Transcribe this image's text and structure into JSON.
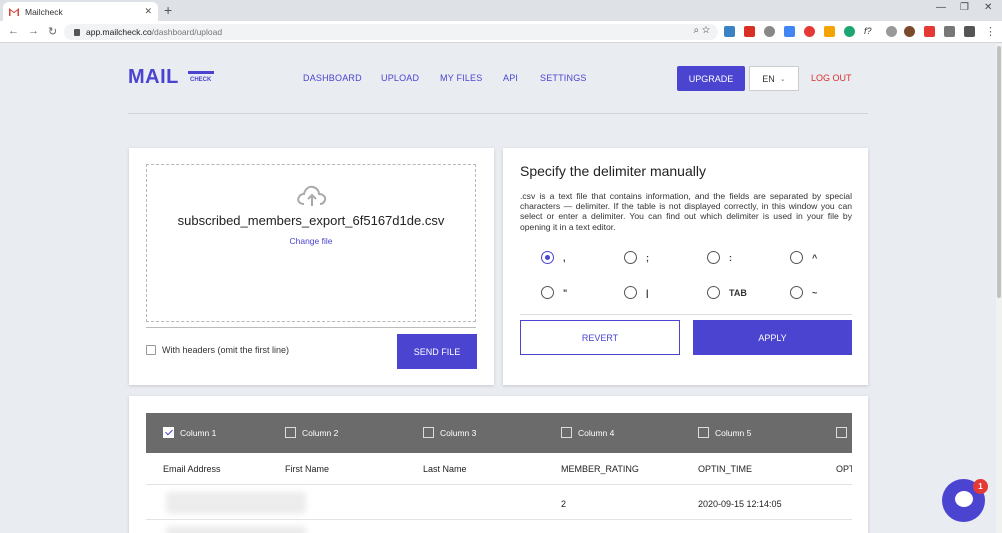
{
  "browser": {
    "tab_title": "Mailcheck",
    "tab_close": "✕",
    "new_tab": "+",
    "url_host": "app.mailcheck.co",
    "url_path": "/dashboard/upload",
    "minimize": "—",
    "restore": "❐",
    "close": "✕"
  },
  "header": {
    "logo_text": "MAIL",
    "logo_sub": "CHECK",
    "nav": [
      "DASHBOARD",
      "UPLOAD",
      "MY FILES",
      "API",
      "SETTINGS"
    ],
    "upgrade_label": "UPGRADE",
    "lang_label": "EN",
    "logout_label": "LOG OUT"
  },
  "upload": {
    "filename": "subscribed_members_export_6f5167d1de.csv",
    "change_label": "Change file",
    "headers_label": "With headers (omit the first line)",
    "send_label": "SEND FILE"
  },
  "delimiter": {
    "title": "Specify the delimiter manually",
    "description": ".csv is a text file that contains information, and the fields are separated by special characters — delimiter. If the table is not displayed correctly, in this window you can select or enter a delimiter. You can find out which delimiter is used in your file by opening it in a text editor.",
    "options": [
      ",",
      ";",
      ":",
      "^",
      "\"",
      "|",
      "TAB",
      "~"
    ],
    "selected_index": 0,
    "revert_label": "REVERT",
    "apply_label": "APPLY"
  },
  "table": {
    "columns": [
      "Column 1",
      "Column 2",
      "Column 3",
      "Column 4",
      "Column 5"
    ],
    "column1_checked": true,
    "headers": [
      "Email Address",
      "First Name",
      "Last Name",
      "MEMBER_RATING",
      "OPTIN_TIME",
      "OPT"
    ],
    "rows": [
      {
        "member_rating": "2",
        "optin_time": "2020-09-15 12:14:05"
      }
    ]
  },
  "chat": {
    "badge": "1"
  },
  "colors": {
    "accent": "#4a44d1",
    "logout": "#d8302f",
    "table_head": "#6b6b6b"
  }
}
